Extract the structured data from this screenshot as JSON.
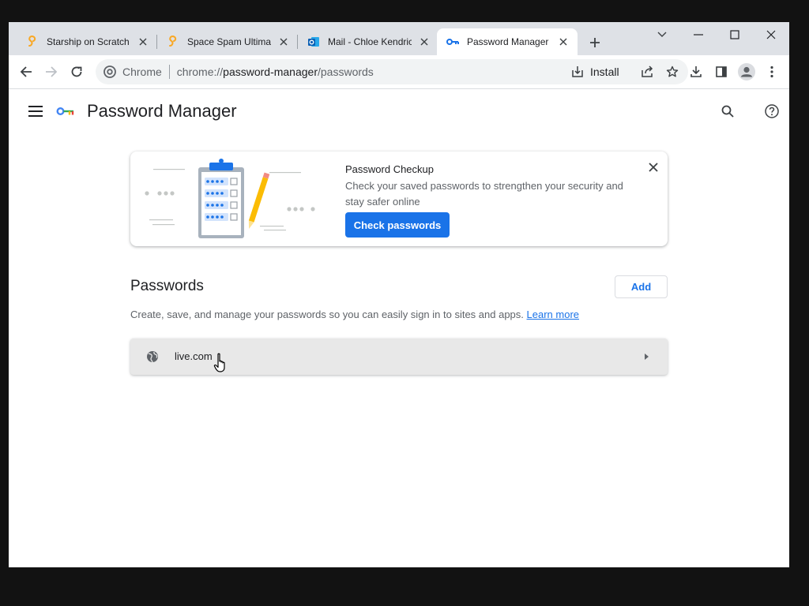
{
  "tabs": [
    {
      "title": "Starship on Scratch",
      "icon": "scratch-icon",
      "active": false
    },
    {
      "title": "Space Spam Ultimate",
      "icon": "scratch-icon",
      "active": false
    },
    {
      "title": "Mail - Chloe Kendrick",
      "icon": "outlook-icon",
      "active": false
    },
    {
      "title": "Password Manager",
      "icon": "key-icon",
      "active": true
    }
  ],
  "omnibox": {
    "chip_label": "Chrome",
    "url_scheme": "chrome://",
    "url_host": "password-manager",
    "url_path": "/passwords",
    "install_label": "Install"
  },
  "header": {
    "title": "Password Manager"
  },
  "promo": {
    "title": "Password Checkup",
    "description": "Check your saved passwords to strengthen your security and stay safer online",
    "button_label": "Check passwords"
  },
  "passwords": {
    "title": "Passwords",
    "add_label": "Add",
    "description": "Create, save, and manage your passwords so you can easily sign in to sites and apps.",
    "learn_more": "Learn more",
    "items": [
      {
        "site": "live.com"
      }
    ]
  },
  "colors": {
    "accent": "#1a73e8",
    "tabstrip": "#dee1e6",
    "row_bg": "#e8e8e8"
  }
}
